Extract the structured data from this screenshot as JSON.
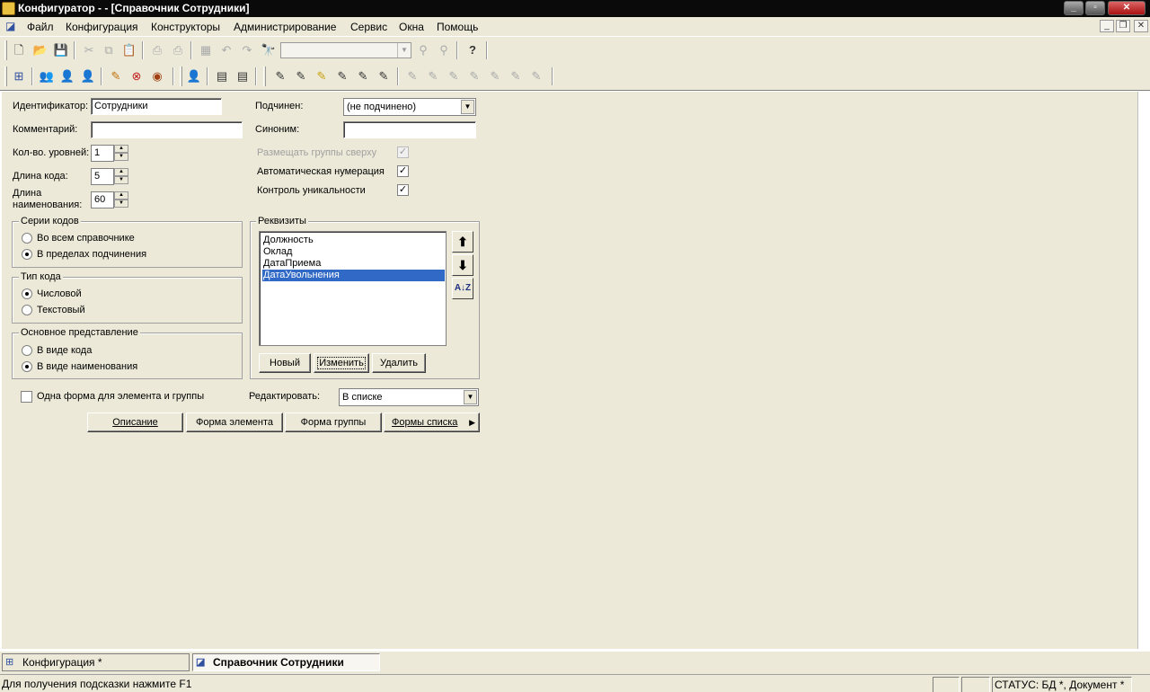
{
  "window": {
    "title": "Конфигуратор -  - [Справочник Сотрудники]",
    "min": "_",
    "max": "▫",
    "close": "✕"
  },
  "menu": {
    "items": [
      "Файл",
      "Конфигурация",
      "Конструкторы",
      "Администрирование",
      "Сервис",
      "Окна",
      "Помощь"
    ],
    "mdi_min": "_",
    "mdi_restore": "❐",
    "mdi_close": "✕"
  },
  "form": {
    "identifier_label": "Идентификатор:",
    "identifier_value": "Сотрудники",
    "comment_label": "Комментарий:",
    "comment_value": "",
    "levels_label": "Кол-во. уровней:",
    "levels_value": "1",
    "code_length_label": "Длина кода:",
    "code_length_value": "5",
    "name_length_label": "Длина наименования:",
    "name_length_value": "60",
    "subordinate_label": "Подчинен:",
    "subordinate_value": "(не подчинено)",
    "synonym_label": "Синоним:",
    "synonym_value": "",
    "groups_on_top_label": "Размещать группы сверху",
    "auto_numbering_label": "Автоматическая нумерация",
    "uniqueness_label": "Контроль уникальности",
    "code_series": {
      "title": "Серии кодов",
      "options": [
        "Во всем справочнике",
        "В пределах подчинения"
      ],
      "selected": 1
    },
    "code_type": {
      "title": "Тип кода",
      "options": [
        "Числовой",
        "Текстовый"
      ],
      "selected": 0
    },
    "main_view": {
      "title": "Основное представление",
      "options": [
        "В виде кода",
        "В виде наименования"
      ],
      "selected": 1
    },
    "attributes": {
      "title": "Реквизиты",
      "items": [
        "Должность",
        "Оклад",
        "ДатаПриема",
        "ДатаУвольнения"
      ],
      "selected": 3,
      "new_button": "Новый",
      "edit_button": "Изменить",
      "delete_button": "Удалить"
    },
    "one_form_label": "Одна форма для элемента и группы",
    "edit_label": "Редактировать:",
    "edit_value": "В списке",
    "description_button": "Описание",
    "element_form_button": "Форма элемента",
    "group_form_button": "Форма группы",
    "list_forms_button": "Формы списка"
  },
  "taskbar": {
    "tasks": [
      "Конфигурация *",
      "Справочник Сотрудники"
    ]
  },
  "status": {
    "hint": "Для получения подсказки нажмите F1",
    "status": "СТАТУС: БД *, Документ *"
  }
}
